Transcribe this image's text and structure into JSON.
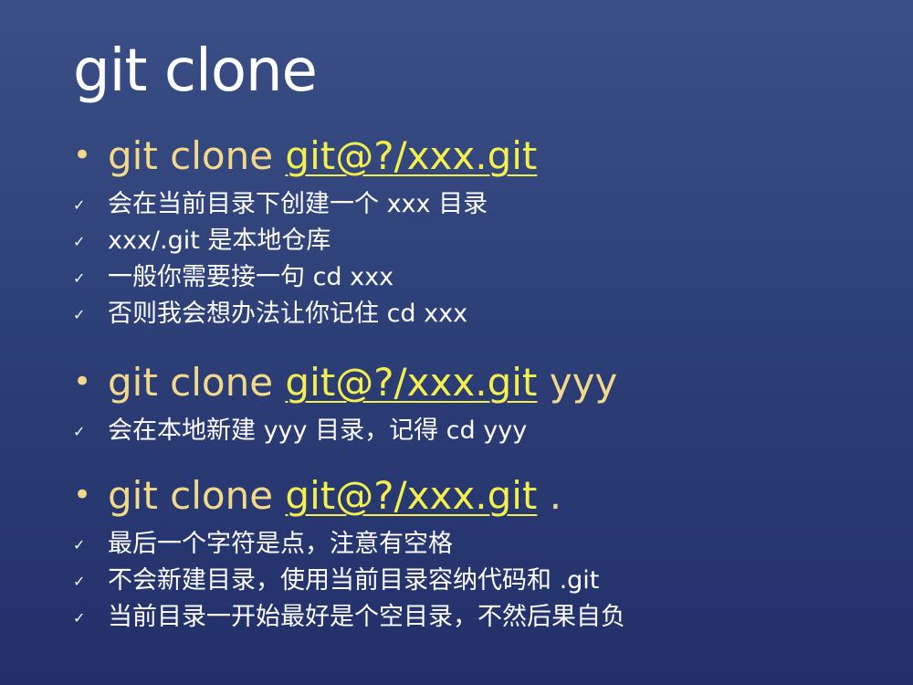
{
  "title": "git clone",
  "sections": [
    {
      "prefix": "git clone ",
      "url": "git@?/xxx.git",
      "suffix": "",
      "items": [
        "会在当前目录下创建一个 xxx 目录",
        "xxx/.git 是本地仓库",
        "一般你需要接一句 cd xxx",
        "否则我会想办法让你记住 cd xxx"
      ]
    },
    {
      "prefix": "git clone ",
      "url": "git@?/xxx.git",
      "suffix": " yyy",
      "items": [
        "会在本地新建 yyy 目录，记得 cd yyy"
      ]
    },
    {
      "prefix": "git clone ",
      "url": "git@?/xxx.git",
      "suffix": " .",
      "items": [
        "最后一个字符是点，注意有空格",
        "不会新建目录，使用当前目录容纳代码和 .git",
        "当前目录一开始最好是个空目录，不然后果自负"
      ]
    }
  ],
  "icons": {
    "bullet": "bullet-dot-icon",
    "check": "checkmark-icon"
  },
  "colors": {
    "background_top": "#3a4f86",
    "background_bottom": "#22306a",
    "title": "#ffffff",
    "bullet_text": "#f2d98a",
    "url": "#f3ef4c",
    "item_text": "#ffffff"
  }
}
